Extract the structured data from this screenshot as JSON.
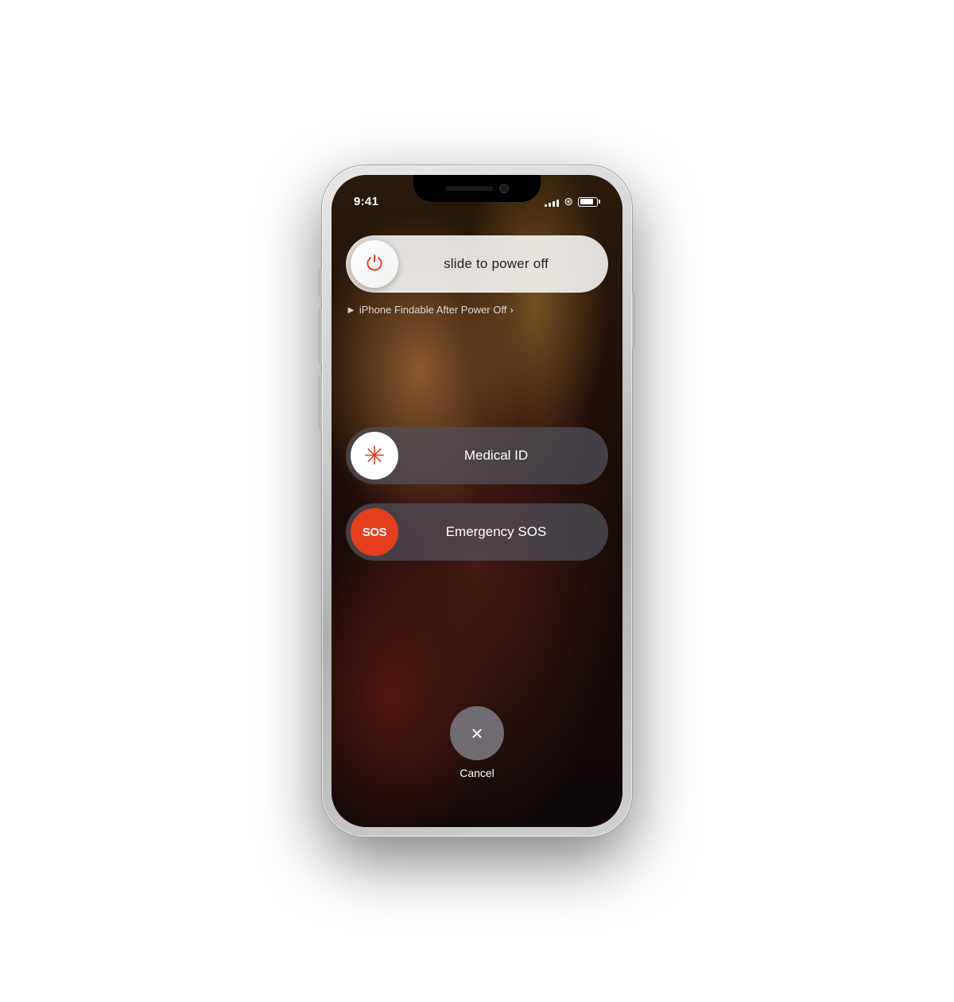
{
  "phone": {
    "status_bar": {
      "time": "9:41",
      "signal_bars": [
        3,
        5,
        7,
        9,
        11
      ],
      "wifi": "wifi",
      "battery_level": 80
    },
    "power_slider": {
      "label": "slide to power off",
      "thumb_icon": "power"
    },
    "findable_text": "iPhone Findable After Power Off",
    "medical_id_slider": {
      "label": "Medical ID",
      "thumb_icon": "asterisk"
    },
    "sos_slider": {
      "label": "Emergency SOS",
      "thumb_icon_text": "SOS"
    },
    "cancel_button": {
      "label": "Cancel",
      "icon": "×"
    }
  }
}
